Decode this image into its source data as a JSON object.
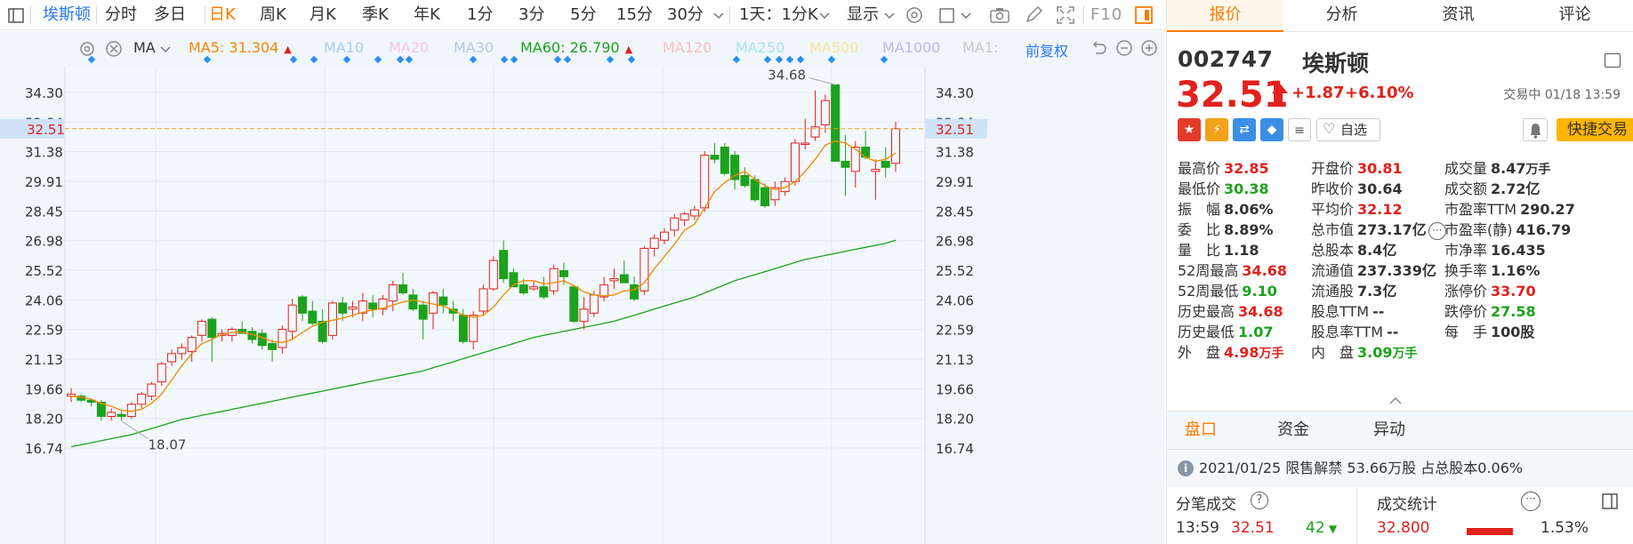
{
  "toolbar": {
    "stock_name": "埃斯顿",
    "periods": [
      "分时",
      "多日",
      "日K",
      "周K",
      "月K",
      "季K",
      "年K",
      "1分",
      "3分",
      "5分",
      "15分",
      "30分"
    ],
    "active_period": "日K",
    "multi_period": "1天：1分K",
    "display": "显示",
    "f10": "F10"
  },
  "ma_bar": {
    "ma_label": "MA",
    "ma5": "MA5: 31.304",
    "ma10": "MA10",
    "ma20": "MA20",
    "ma30": "MA30",
    "ma60": "MA60: 26.790",
    "ma120": "MA120",
    "ma250": "MA250",
    "ma500": "MA500",
    "ma1000": "MA1000",
    "ma1": "MA1:",
    "adjust": "前复权",
    "colors": {
      "ma5": "#f08a00",
      "ma10": "#7fb2e5",
      "ma20": "#f0b3d6",
      "ma30": "#b0c4de",
      "ma60": "#1ca21c",
      "ma120": "#f7b2b2",
      "ma250": "#8fd8e8",
      "ma500": "#f6e27f",
      "ma1000": "#b8a9e0",
      "ma1": "#bbbbbb"
    }
  },
  "chart_data": {
    "type": "candlestick",
    "y_ticks": [
      "34.30",
      "32.84",
      "31.38",
      "29.91",
      "28.45",
      "26.98",
      "25.52",
      "24.06",
      "22.59",
      "21.13",
      "19.66",
      "18.20",
      "16.74"
    ],
    "ylim": [
      16.74,
      34.3
    ],
    "current_price": "32.51",
    "high_annotation": "34.68",
    "low_annotation": "18.07",
    "colors": {
      "up": "#e0211d",
      "down": "#1ca21c",
      "ma5": "#f08a00",
      "ma60": "#1ca21c",
      "current_line": "#f0a020",
      "marker": "#2a8ff0"
    },
    "candles": [
      [
        19.3,
        19.7,
        19.0,
        19.4
      ],
      [
        19.3,
        19.4,
        19.0,
        19.1
      ],
      [
        19.1,
        19.2,
        18.8,
        19.0
      ],
      [
        19.0,
        19.1,
        18.1,
        18.3
      ],
      [
        18.3,
        18.7,
        18.1,
        18.5
      ],
      [
        18.4,
        18.6,
        18.1,
        18.3
      ],
      [
        18.3,
        19.0,
        18.2,
        18.9
      ],
      [
        18.9,
        19.5,
        18.7,
        19.4
      ],
      [
        19.3,
        20.0,
        19.1,
        19.9
      ],
      [
        20.0,
        21.0,
        19.8,
        20.9
      ],
      [
        21.0,
        21.6,
        20.8,
        21.4
      ],
      [
        21.4,
        21.9,
        21.1,
        21.7
      ],
      [
        21.5,
        22.3,
        21.0,
        22.2
      ],
      [
        22.3,
        23.1,
        22.0,
        23.0
      ],
      [
        23.1,
        23.2,
        21.0,
        22.2
      ],
      [
        22.3,
        22.6,
        22.0,
        22.4
      ],
      [
        22.3,
        22.7,
        22.0,
        22.6
      ],
      [
        22.6,
        23.0,
        22.4,
        22.4
      ],
      [
        22.5,
        22.7,
        21.9,
        22.1
      ],
      [
        22.4,
        22.6,
        21.6,
        21.8
      ],
      [
        21.9,
        22.1,
        21.0,
        21.6
      ],
      [
        21.7,
        22.8,
        21.4,
        22.6
      ],
      [
        22.5,
        24.1,
        22.1,
        23.8
      ],
      [
        24.2,
        24.3,
        23.0,
        23.4
      ],
      [
        23.5,
        24.0,
        22.8,
        22.9
      ],
      [
        23.0,
        23.6,
        21.9,
        22.0
      ],
      [
        22.3,
        24.0,
        22.1,
        23.9
      ],
      [
        23.9,
        24.2,
        23.0,
        23.4
      ],
      [
        23.6,
        24.0,
        23.2,
        23.7
      ],
      [
        23.4,
        24.4,
        23.0,
        24.0
      ],
      [
        23.9,
        24.3,
        23.2,
        23.6
      ],
      [
        23.6,
        24.3,
        23.3,
        24.1
      ],
      [
        24.0,
        25.0,
        23.5,
        24.8
      ],
      [
        24.8,
        25.4,
        24.3,
        24.4
      ],
      [
        24.3,
        24.6,
        23.5,
        23.6
      ],
      [
        23.8,
        24.0,
        22.1,
        23.1
      ],
      [
        23.4,
        24.5,
        22.6,
        24.4
      ],
      [
        24.2,
        24.6,
        23.4,
        23.8
      ],
      [
        23.6,
        24.0,
        23.0,
        23.4
      ],
      [
        23.3,
        23.6,
        21.9,
        22.0
      ],
      [
        22.0,
        23.5,
        21.6,
        23.3
      ],
      [
        23.5,
        24.8,
        23.3,
        24.6
      ],
      [
        24.6,
        26.2,
        24.5,
        26.0
      ],
      [
        26.5,
        27.0,
        24.9,
        25.1
      ],
      [
        25.4,
        25.6,
        24.8,
        24.7
      ],
      [
        24.8,
        25.1,
        24.3,
        24.4
      ],
      [
        24.6,
        25.0,
        24.5,
        24.7
      ],
      [
        24.7,
        25.2,
        24.1,
        24.2
      ],
      [
        24.5,
        25.8,
        24.3,
        25.6
      ],
      [
        25.5,
        25.9,
        24.8,
        25.2
      ],
      [
        24.7,
        24.8,
        22.9,
        23.0
      ],
      [
        23.0,
        24.2,
        22.6,
        23.6
      ],
      [
        23.4,
        24.5,
        23.2,
        24.3
      ],
      [
        24.2,
        25.2,
        24.0,
        24.8
      ],
      [
        25.0,
        25.6,
        24.6,
        25.1
      ],
      [
        25.3,
        26.0,
        24.9,
        24.9
      ],
      [
        24.8,
        25.2,
        24.0,
        24.1
      ],
      [
        24.5,
        26.7,
        24.3,
        26.6
      ],
      [
        26.6,
        27.3,
        26.2,
        27.1
      ],
      [
        27.0,
        27.6,
        26.8,
        27.4
      ],
      [
        27.5,
        28.3,
        27.2,
        28.1
      ],
      [
        28.0,
        28.4,
        27.7,
        28.3
      ],
      [
        28.2,
        28.7,
        28.0,
        28.5
      ],
      [
        28.6,
        31.4,
        28.4,
        31.2
      ],
      [
        31.2,
        31.8,
        30.8,
        31.0
      ],
      [
        31.6,
        31.8,
        30.2,
        30.3
      ],
      [
        31.2,
        31.4,
        29.5,
        30.0
      ],
      [
        30.2,
        30.6,
        29.6,
        29.7
      ],
      [
        30.0,
        30.2,
        28.9,
        29.0
      ],
      [
        29.6,
        29.8,
        28.6,
        28.7
      ],
      [
        29.0,
        29.9,
        28.7,
        29.6
      ],
      [
        29.4,
        30.1,
        29.2,
        29.9
      ],
      [
        29.9,
        32.0,
        29.7,
        31.8
      ],
      [
        31.8,
        33.0,
        31.5,
        31.8
      ],
      [
        32.1,
        34.4,
        31.9,
        32.6
      ],
      [
        32.7,
        34.2,
        32.3,
        33.9
      ],
      [
        34.68,
        34.68,
        30.9,
        30.9
      ],
      [
        30.9,
        32.2,
        29.2,
        30.6
      ],
      [
        30.4,
        31.9,
        29.6,
        31.6
      ],
      [
        31.6,
        32.4,
        31.0,
        31.1
      ],
      [
        30.4,
        31.0,
        29.0,
        30.5
      ],
      [
        30.9,
        31.6,
        30.1,
        30.6
      ],
      [
        30.8,
        32.85,
        30.38,
        32.51
      ]
    ],
    "ma5": [
      19.3,
      19.25,
      19.15,
      18.95,
      18.8,
      18.6,
      18.55,
      18.65,
      18.95,
      19.4,
      20.1,
      20.8,
      21.4,
      21.9,
      22.1,
      22.35,
      22.45,
      22.45,
      22.35,
      22.2,
      22.0,
      21.95,
      22.1,
      22.45,
      22.75,
      22.95,
      23.05,
      23.15,
      23.3,
      23.45,
      23.55,
      23.65,
      23.8,
      23.95,
      24.05,
      23.95,
      23.85,
      23.75,
      23.55,
      23.3,
      23.2,
      23.3,
      23.7,
      24.3,
      24.8,
      25.0,
      25.0,
      24.85,
      24.9,
      25.0,
      24.75,
      24.45,
      24.3,
      24.25,
      24.3,
      24.5,
      24.55,
      24.9,
      25.6,
      26.2,
      26.8,
      27.5,
      27.8,
      28.6,
      29.4,
      29.85,
      30.2,
      30.4,
      30.0,
      29.7,
      29.5,
      29.6,
      29.9,
      30.4,
      31.0,
      31.7,
      31.9,
      31.8,
      31.5,
      31.1,
      30.9,
      31.0,
      31.3
    ],
    "ma60": [
      16.8,
      16.9,
      17.0,
      17.1,
      17.2,
      17.3,
      17.4,
      17.55,
      17.7,
      17.85,
      18.0,
      18.15,
      18.25,
      18.35,
      18.45,
      18.55,
      18.65,
      18.75,
      18.85,
      18.95,
      19.05,
      19.15,
      19.25,
      19.35,
      19.45,
      19.55,
      19.65,
      19.75,
      19.85,
      19.95,
      20.05,
      20.15,
      20.25,
      20.35,
      20.45,
      20.55,
      20.7,
      20.85,
      21.0,
      21.15,
      21.3,
      21.45,
      21.6,
      21.75,
      21.9,
      22.05,
      22.2,
      22.3,
      22.4,
      22.5,
      22.6,
      22.7,
      22.8,
      22.9,
      23.0,
      23.15,
      23.3,
      23.45,
      23.6,
      23.75,
      23.9,
      24.05,
      24.2,
      24.4,
      24.6,
      24.8,
      25.0,
      25.15,
      25.3,
      25.45,
      25.6,
      25.75,
      25.9,
      26.05,
      26.15,
      26.25,
      26.35,
      26.45,
      26.55,
      26.65,
      26.75,
      26.85,
      27.0
    ]
  },
  "panel": {
    "tabs": [
      "报价",
      "分析",
      "资讯",
      "评论"
    ],
    "active_tab": "报价",
    "code": "002747",
    "name": "埃斯顿",
    "price": "32.51",
    "change": "+1.87",
    "change_pct": "+6.10%",
    "status": "交易中 01/18 13:59",
    "zixuan": "自选",
    "quick_trade": "快捷交易",
    "quotes": {
      "col1": [
        {
          "label": "最高价",
          "value": "32.85",
          "color": "red"
        },
        {
          "label": "最低价",
          "value": "30.38",
          "color": "green"
        },
        {
          "label": "振　幅",
          "value": "8.06%",
          "color": "dark"
        },
        {
          "label": "委　比",
          "value": "8.89%",
          "color": "dark"
        },
        {
          "label": "量　比",
          "value": "1.18",
          "color": "dark"
        },
        {
          "label": "52周最高",
          "value": "34.68",
          "color": "red"
        },
        {
          "label": "52周最低",
          "value": "9.10",
          "color": "green"
        },
        {
          "label": "历史最高",
          "value": "34.68",
          "color": "red"
        },
        {
          "label": "历史最低",
          "value": "1.07",
          "color": "green"
        },
        {
          "label": "外　盘",
          "value": "4.98",
          "unit": "万手",
          "color": "red"
        }
      ],
      "col2": [
        {
          "label": "开盘价",
          "value": "30.81",
          "color": "red"
        },
        {
          "label": "昨收价",
          "value": "30.64",
          "color": "dark"
        },
        {
          "label": "平均价",
          "value": "32.12",
          "color": "red"
        },
        {
          "label": "总市值",
          "value": "273.17亿",
          "color": "dark"
        },
        {
          "label": "总股本",
          "value": "8.4亿",
          "color": "dark"
        },
        {
          "label": "流通值",
          "value": "237.339亿",
          "color": "dark"
        },
        {
          "label": "流通股",
          "value": "7.3亿",
          "color": "dark"
        },
        {
          "label": "股息TTM",
          "value": "--",
          "color": "dark"
        },
        {
          "label": "股息率TTM",
          "value": "--",
          "color": "dark"
        },
        {
          "label": "内　盘",
          "value": "3.09",
          "unit": "万手",
          "color": "green"
        }
      ],
      "col3": [
        {
          "label": "成交量",
          "value": "8.47",
          "unit": "万手",
          "color": "dark"
        },
        {
          "label": "成交额",
          "value": "2.72亿",
          "color": "dark"
        },
        {
          "label": "市盈率TTM",
          "value": "290.27",
          "color": "dark"
        },
        {
          "label": "市盈率(静)",
          "value": "416.79",
          "color": "dark"
        },
        {
          "label": "市净率",
          "value": "16.435",
          "color": "dark"
        },
        {
          "label": "换手率",
          "value": "1.16%",
          "color": "dark"
        },
        {
          "label": "涨停价",
          "value": "33.70",
          "color": "red"
        },
        {
          "label": "跌停价",
          "value": "27.58",
          "color": "green"
        },
        {
          "label": "每　手",
          "value": "100股",
          "color": "dark"
        }
      ]
    },
    "subtabs": [
      "盘口",
      "资金",
      "异动"
    ],
    "active_subtab": "盘口",
    "notice": "2021/01/25  限售解禁 53.66万股 占总股本0.06%",
    "tick": {
      "title": "分笔成交",
      "stats_title": "成交统计",
      "row_time": "13:59",
      "row_price": "32.51",
      "row_vol": "42",
      "stat_price": "32.800",
      "stat_pct": "1.53%"
    }
  }
}
